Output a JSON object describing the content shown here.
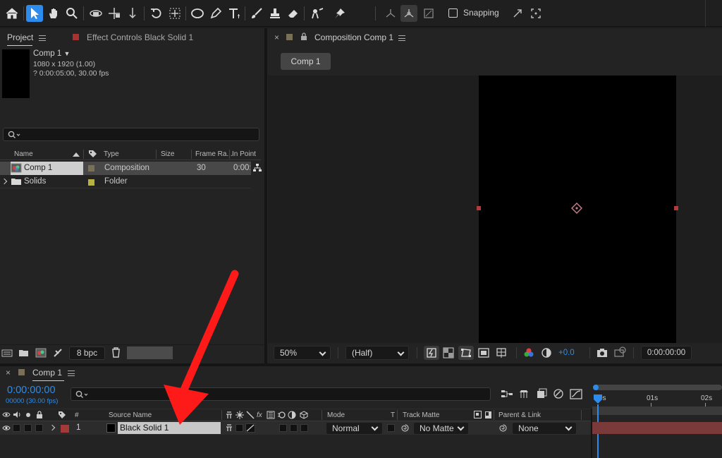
{
  "toolbar": {
    "snapping_label": "Snapping",
    "tools": [
      "home-icon",
      "selection-arrow-icon",
      "hand-icon",
      "zoom-icon",
      "rotate-camera-icon",
      "move-camera-icon",
      "dolly-camera-icon",
      "rotate-icon",
      "pan-behind-icon",
      "ellipse-icon",
      "pen-icon",
      "type-icon",
      "brush-icon",
      "clone-stamp-icon",
      "eraser-icon",
      "roto-brush-icon",
      "puppet-pin-icon"
    ]
  },
  "project_panel": {
    "tab_label": "Project",
    "effect_controls_label": "Effect Controls Black Solid 1",
    "preview": {
      "name": "Comp 1",
      "size_info": "1080 x 1920 (1.00)",
      "duration_info": "? 0:00:05:00, 30.00 fps"
    },
    "search_placeholder": "",
    "columns": {
      "name": "Name",
      "type": "Type",
      "size": "Size",
      "frame_rate": "Frame Ra...",
      "in_point": "In Point"
    },
    "items": [
      {
        "name": "Comp 1",
        "type": "Composition",
        "frame_rate": "30",
        "in_point": "0:00:",
        "label_color": "#7a6f57"
      },
      {
        "name": "Solids",
        "type": "Folder",
        "frame_rate": "",
        "in_point": "",
        "label_color": "#b8b23e"
      }
    ],
    "footer": {
      "bpc_label": "8 bpc"
    }
  },
  "composition_panel": {
    "tab_label": "Composition Comp 1",
    "comp_tab_button": "Comp 1",
    "zoom_value": "50%",
    "resolution_value": "(Half)",
    "exposure_value": "+0.0",
    "timecode_value": "0:00:00:00",
    "label_color": "#7a6f57"
  },
  "timeline_panel": {
    "tab_label": "Comp 1",
    "current_time": "0:00:00:00",
    "frames_info": "00000 (30.00 fps)",
    "search_placeholder": "",
    "columns": {
      "hash": "#",
      "source_name": "Source Name",
      "fx": "fx",
      "mode": "Mode",
      "t": "T",
      "track_matte": "Track Matte",
      "parent_link": "Parent & Link"
    },
    "ruler": {
      "marks": [
        "0s",
        "01s",
        "02s"
      ]
    },
    "layers": [
      {
        "number": "1",
        "source_name": "Black Solid 1",
        "mode": "Normal",
        "track_matte": "No Matte",
        "parent": "None",
        "label_color": "#a23a3a"
      }
    ]
  },
  "colors": {
    "accent_blue": "#2d8ceb",
    "annotation_red": "#ff0000",
    "layer_bar": "#7a3a3a"
  }
}
